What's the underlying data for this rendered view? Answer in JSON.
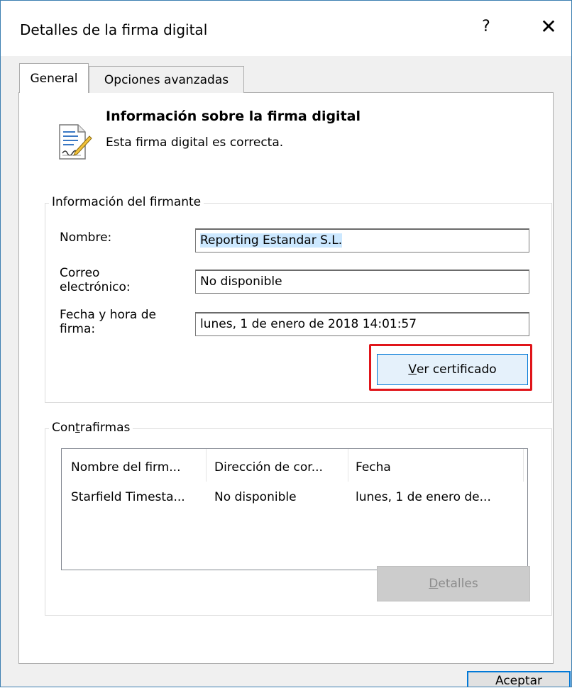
{
  "window": {
    "title": "Detalles de la firma digital",
    "help_glyph": "?",
    "close_glyph": "✕"
  },
  "tabs": [
    {
      "label": "General",
      "selected": true
    },
    {
      "label": "Opciones avanzadas",
      "selected": false
    }
  ],
  "header": {
    "icon": "signed-document-icon",
    "title": "Información sobre la firma digital",
    "subtitle": "Esta firma digital es correcta."
  },
  "signer": {
    "legend": "Información del firmante",
    "name_label": "Nombre:",
    "name_value": "Reporting Estandar S.L.",
    "email_label_line1": "Correo",
    "email_label_line2": "electrónico:",
    "email_value": "No disponible",
    "date_label_line1": "Fecha y hora de",
    "date_label_line2": "firma:",
    "date_value": "lunes, 1 de enero de 2018 14:01:57",
    "view_cert_prefix": "V",
    "view_cert_rest": "er certificado"
  },
  "countersignatures": {
    "legend_prefix": "Con",
    "legend_accel": "t",
    "legend_rest": "rafirmas",
    "columns": [
      "Nombre del firm...",
      "Dirección de cor...",
      "Fecha"
    ],
    "rows": [
      [
        "Starfield Timesta...",
        "No disponible",
        "lunes, 1 de enero de..."
      ]
    ],
    "details_accel": "D",
    "details_rest": "etalles"
  },
  "footer": {
    "accept_label": "Aceptar"
  },
  "colors": {
    "highlight_outline": "#e0151a",
    "selection": "#cce8ff",
    "focus_blue": "#0078d7"
  }
}
